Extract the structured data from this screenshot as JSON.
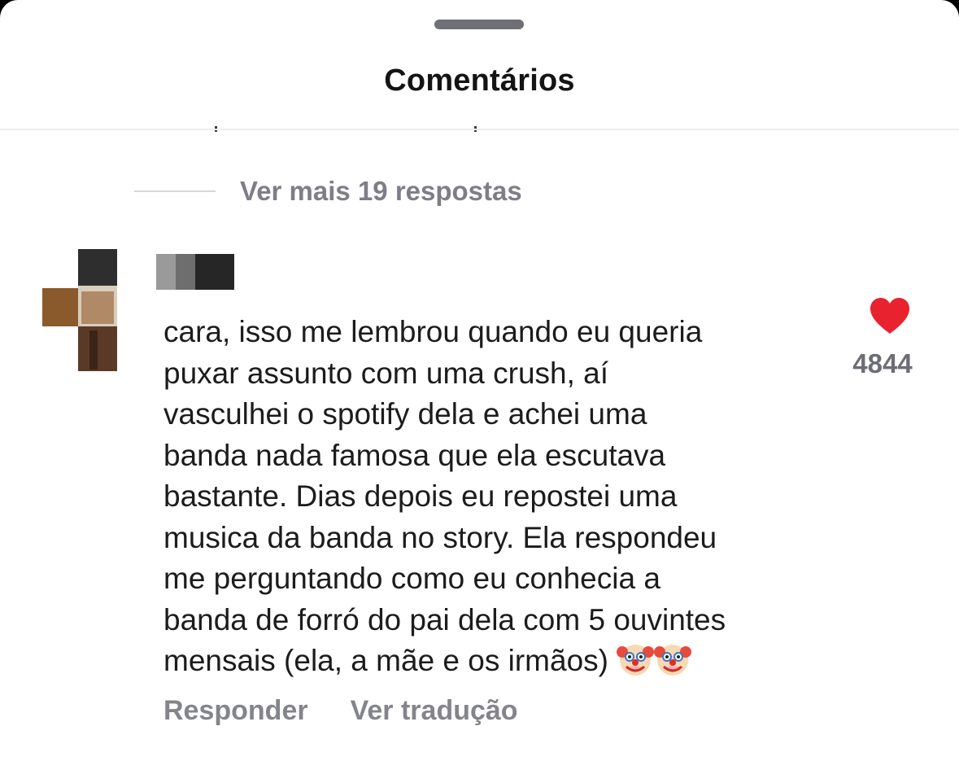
{
  "sheet": {
    "title": "Comentários"
  },
  "thread": {
    "more_replies_label": "Ver mais 19 respostas"
  },
  "comment": {
    "lines": [
      "cara, isso me lembrou quando eu queria",
      "puxar assunto com uma crush, aí",
      "vasculhei o spotify dela e achei uma",
      "banda nada famosa que ela escutava",
      "bastante. Dias depois eu repostei uma",
      "musica da banda no story. Ela respondeu",
      "me perguntando como eu conhecia a",
      "banda de forró do pai dela com 5 ouvintes",
      "mensais (ela, a mãe e os irmãos)"
    ],
    "trailing_emojis": [
      "clown-face",
      "clown-face"
    ],
    "like_count": "4844",
    "liked": true,
    "reply_label": "Responder",
    "translate_label": "Ver tradução"
  },
  "colors": {
    "like_heart": "#e8232f",
    "muted_text": "#7e7e86",
    "body_text": "#1c1c1c"
  }
}
